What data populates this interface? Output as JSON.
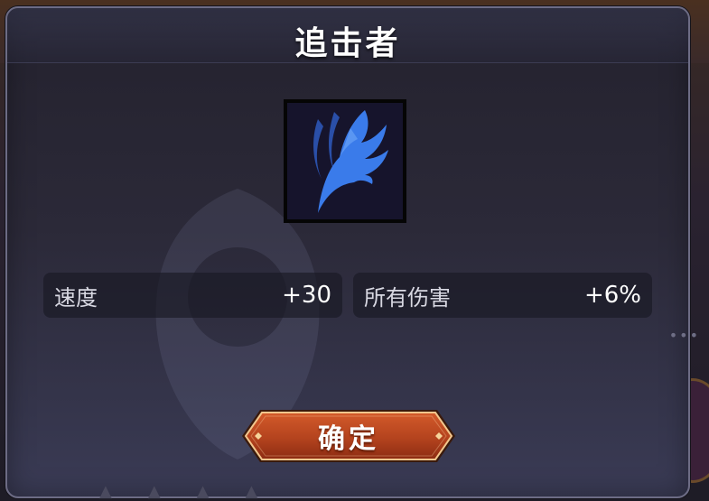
{
  "dialog": {
    "title": "追击者",
    "icon": "blue-wing-icon"
  },
  "stats": [
    {
      "label": "速度",
      "value": "+30"
    },
    {
      "label": "所有伤害",
      "value": "+6%"
    }
  ],
  "confirm_button": {
    "label": "确定"
  },
  "colors": {
    "wing": "#3a7bea",
    "wing_shadow": "#2a4fa8",
    "button_fill": "#b4431e",
    "button_border": "#f2c68c"
  }
}
